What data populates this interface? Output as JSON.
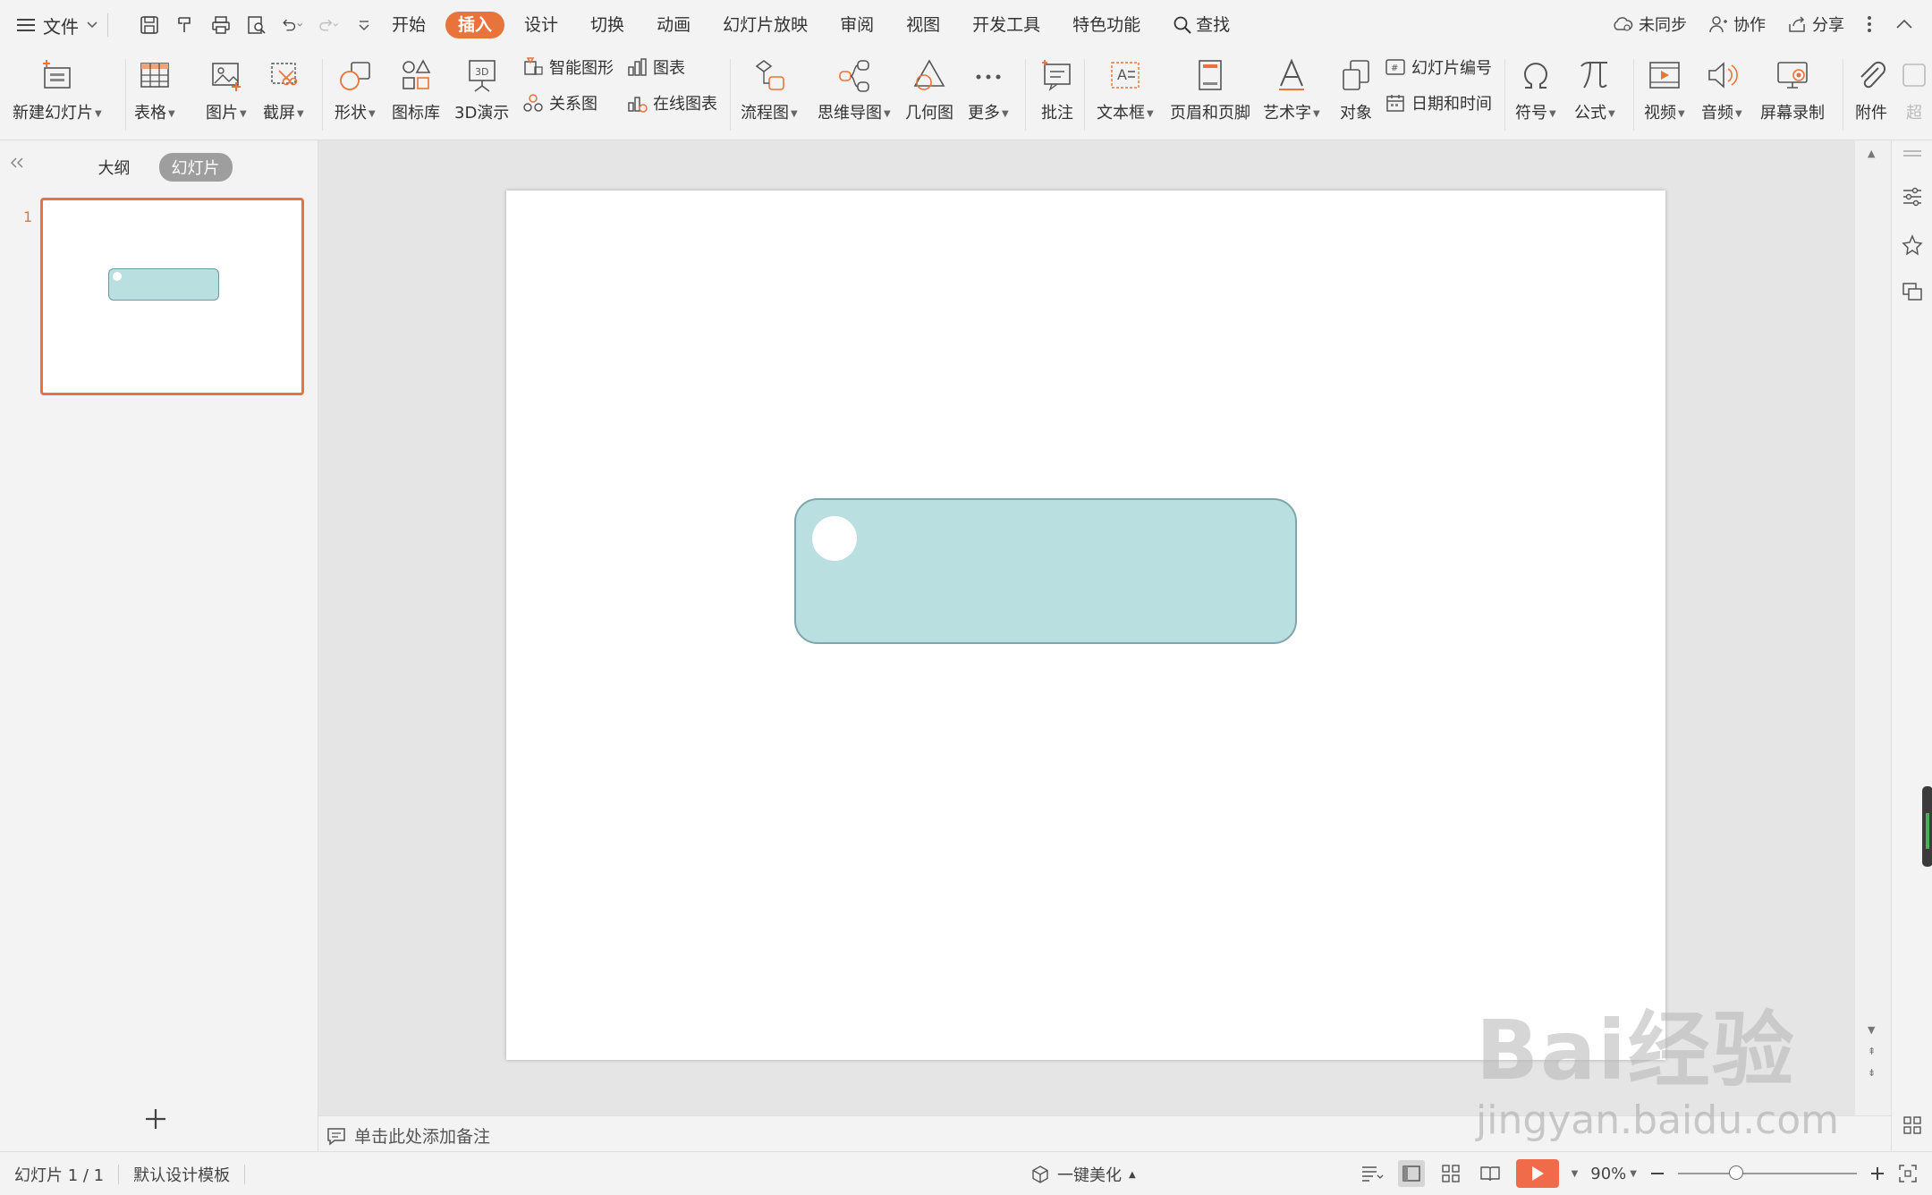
{
  "menu": {
    "file_label": "文件",
    "tabs": [
      "开始",
      "插入",
      "设计",
      "切换",
      "动画",
      "幻灯片放映",
      "审阅",
      "视图",
      "开发工具",
      "特色功能"
    ],
    "active_tab": "插入",
    "search_label": "查找",
    "right": {
      "sync": "未同步",
      "collab": "协作",
      "share": "分享"
    }
  },
  "ribbon": {
    "new_slide": "新建幻灯片",
    "table": "表格",
    "picture": "图片",
    "screenshot": "截屏",
    "shape": "形状",
    "icon_library": "图标库",
    "demo_3d": "3D演示",
    "smart_graphic": "智能图形",
    "chart": "图表",
    "relation": "关系图",
    "online_chart": "在线图表",
    "flowchart": "流程图",
    "mindmap": "思维导图",
    "geometry": "几何图",
    "more": "更多",
    "comment": "批注",
    "textbox": "文本框",
    "header_footer": "页眉和页脚",
    "wordart": "艺术字",
    "object": "对象",
    "slide_number": "幻灯片编号",
    "datetime": "日期和时间",
    "symbol": "符号",
    "formula": "公式",
    "video": "视频",
    "audio": "音频",
    "screen_record": "屏幕录制",
    "attachment": "附件",
    "truncated": "超"
  },
  "panel": {
    "tab_outline": "大纲",
    "tab_slides": "幻灯片",
    "slide_number": "1"
  },
  "notes": {
    "placeholder": "单击此处添加备注"
  },
  "status": {
    "slide_info": "幻灯片 1 / 1",
    "template": "默认设计模板",
    "beautify": "一键美化",
    "zoom": "90%",
    "zoom_fraction": 0.9
  },
  "colors": {
    "accent": "#e8743b",
    "shape_fill": "#b9dfe1",
    "shape_border": "#7fa6ab",
    "play": "#ef6b4a"
  },
  "watermark": {
    "brand": "Bai经验",
    "url": "jingyan.baidu.com"
  }
}
